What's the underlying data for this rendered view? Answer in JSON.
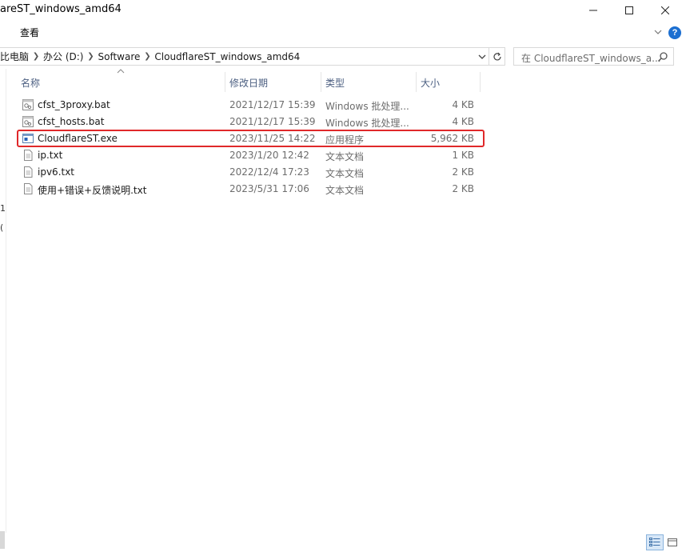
{
  "window": {
    "title": "areST_windows_amd64",
    "controls": [
      "minimize",
      "maximize",
      "close"
    ]
  },
  "ribbon": {
    "tab_view": "查看"
  },
  "address": {
    "crumbs": [
      "此电脑",
      "办公 (D:)",
      "Software",
      "CloudflareST_windows_amd64"
    ],
    "crumb_pc": "比电脑",
    "crumb_drive": "办公 (D:)",
    "crumb_software": "Software",
    "crumb_folder": "CloudflareST_windows_amd64"
  },
  "search": {
    "placeholder": "在 CloudflareST_windows_a..."
  },
  "nav_fragments": [
    "1",
    "("
  ],
  "columns": {
    "name": "名称",
    "date": "修改日期",
    "type": "类型",
    "size": "大小"
  },
  "files": [
    {
      "name": "cfst_3proxy.bat",
      "date": "2021/12/17 15:39",
      "type": "Windows 批处理...",
      "size": "4 KB",
      "icon": "batch-file-icon"
    },
    {
      "name": "cfst_hosts.bat",
      "date": "2021/12/17 15:39",
      "type": "Windows 批处理...",
      "size": "4 KB",
      "icon": "batch-file-icon"
    },
    {
      "name": "CloudflareST.exe",
      "date": "2023/11/25 14:22",
      "type": "应用程序",
      "size": "5,962 KB",
      "icon": "application-icon"
    },
    {
      "name": "ip.txt",
      "date": "2023/1/20 12:42",
      "type": "文本文档",
      "size": "1 KB",
      "icon": "text-file-icon"
    },
    {
      "name": "ipv6.txt",
      "date": "2022/12/4 17:23",
      "type": "文本文档",
      "size": "2 KB",
      "icon": "text-file-icon"
    },
    {
      "name": "使用+错误+反馈说明.txt",
      "date": "2023/5/31 17:06",
      "type": "文本文档",
      "size": "2 KB",
      "icon": "text-file-icon"
    }
  ],
  "highlight_color": "#e0282a",
  "accent_color": "#1c6fd1"
}
